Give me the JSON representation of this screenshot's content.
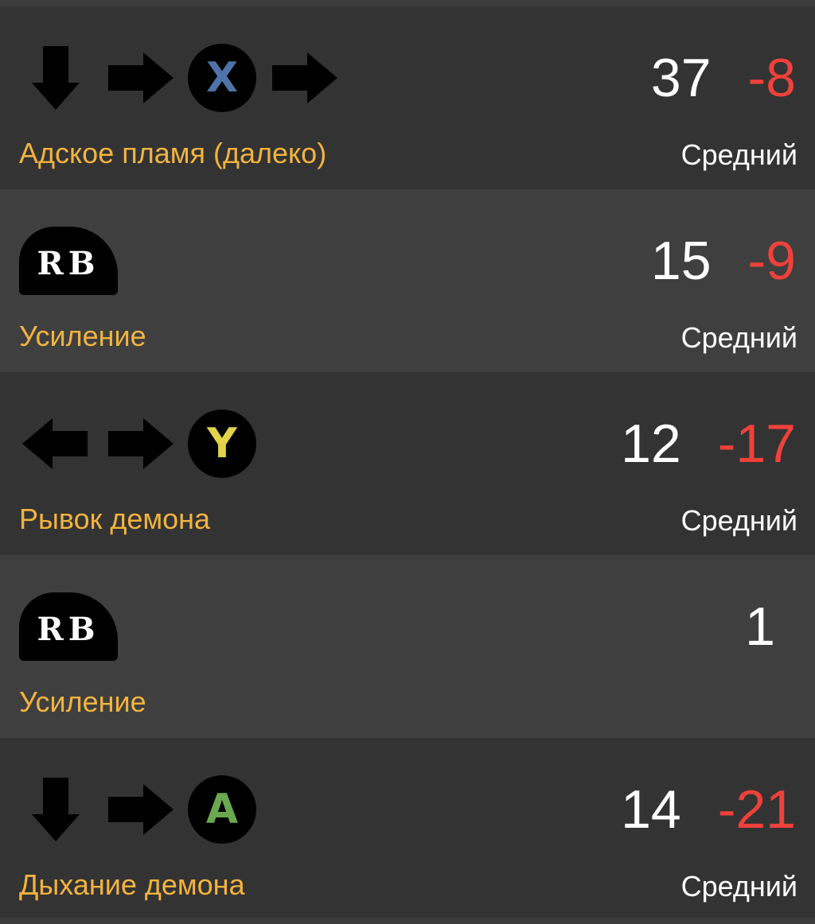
{
  "colors": {
    "x_button": "#4f73a8",
    "y_button": "#e2d24a",
    "a_button": "#6aa84f",
    "move_name": "#f2b33d",
    "recovery": "#f0413a"
  },
  "moves": [
    {
      "name": "Адское пламя (далеко)",
      "startup": "37",
      "recovery": "-8",
      "hit_level": "Средний",
      "inputs": [
        "arrow-down",
        "arrow-right",
        "X",
        "arrow-right"
      ]
    },
    {
      "name": "Усиление",
      "startup": "15",
      "recovery": "-9",
      "hit_level": "Средний",
      "inputs": [
        "RB"
      ]
    },
    {
      "name": "Рывок демона",
      "startup": "12",
      "recovery": "-17",
      "hit_level": "Средний",
      "inputs": [
        "arrow-left",
        "arrow-right",
        "Y"
      ]
    },
    {
      "name": "Усиление",
      "startup": "1",
      "recovery": "",
      "hit_level": "",
      "inputs": [
        "RB"
      ]
    },
    {
      "name": "Дыхание демона",
      "startup": "14",
      "recovery": "-21",
      "hit_level": "Средний",
      "inputs": [
        "arrow-down",
        "arrow-right",
        "A"
      ]
    }
  ]
}
